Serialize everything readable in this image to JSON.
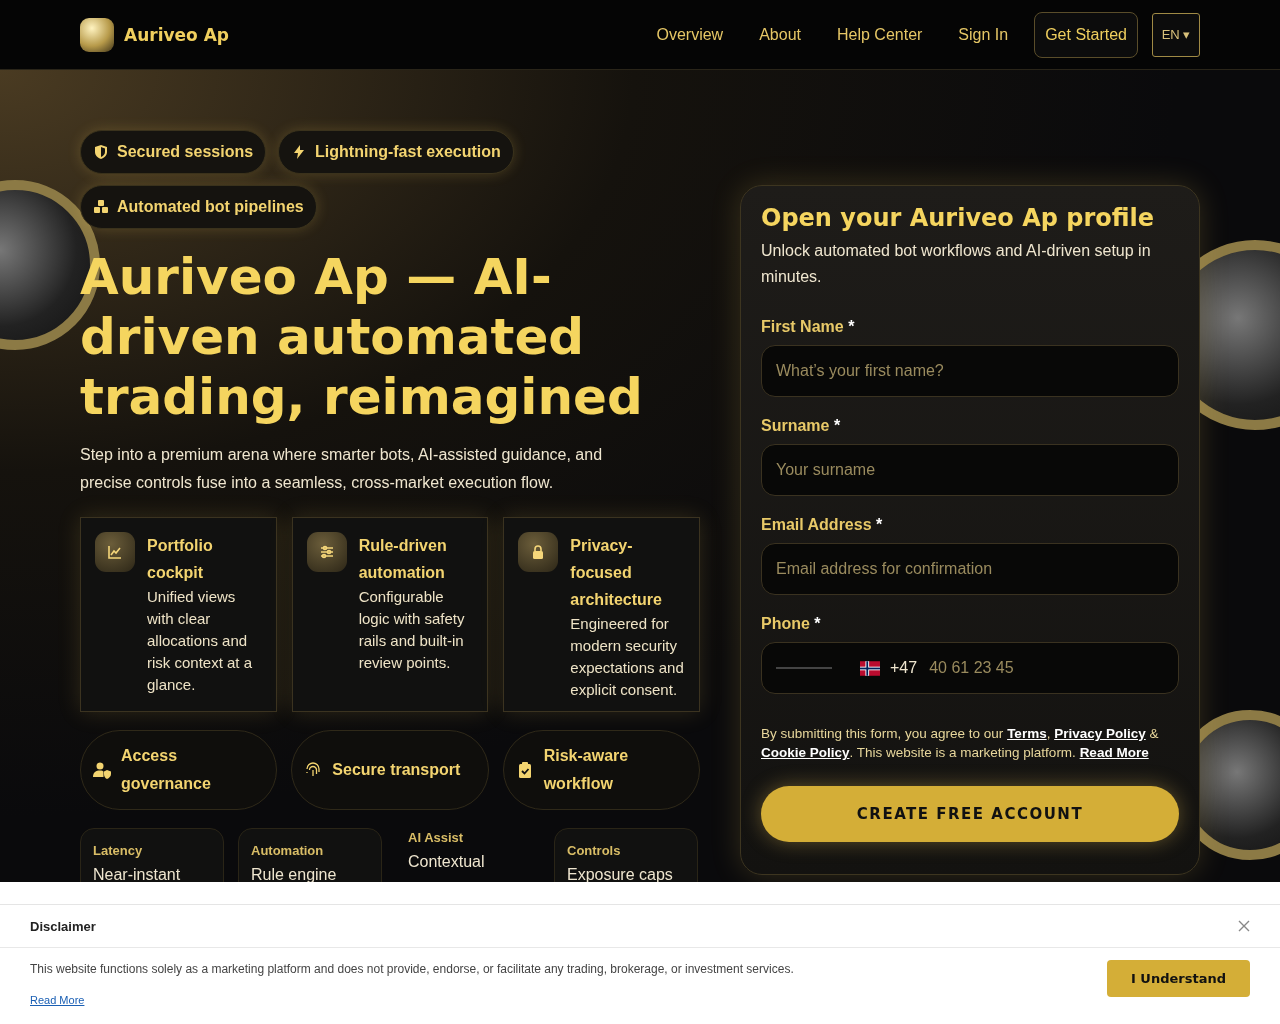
{
  "header": {
    "brand": "Auriveo Ap",
    "links": [
      "Overview",
      "About",
      "Help Center",
      "Sign In"
    ],
    "cta": "Get Started",
    "language": "EN ▾"
  },
  "hero": {
    "badges": [
      {
        "kind": "shield",
        "label": "Secured sessions"
      },
      {
        "kind": "bolt",
        "label": "Lightning-fast execution"
      },
      {
        "kind": "cubes",
        "label": "Automated bot pipelines"
      }
    ],
    "title": "Auriveo Ap — AI-driven automated trading, reimagined",
    "lead": "Step into a premium arena where smarter bots, AI-assisted guidance, and precise controls fuse into a seamless, cross-market execution flow.",
    "features": [
      {
        "kind": "chart",
        "title": "Portfolio cockpit",
        "text": "Unified views with clear allocations and risk context at a glance."
      },
      {
        "kind": "sliders",
        "title": "Rule-driven automation",
        "text": "Configurable logic with safety rails and built-in review points."
      },
      {
        "kind": "lock",
        "title": "Privacy-focused architecture",
        "text": "Engineered for modern security expectations and explicit consent."
      }
    ],
    "pills": [
      {
        "kind": "access",
        "label": "Access governance"
      },
      {
        "kind": "transport",
        "label": "Secure transport"
      },
      {
        "kind": "workflow",
        "label": "Risk-aware workflow"
      }
    ],
    "stats": [
      {
        "kind": "card",
        "label": "Latency",
        "value": "Near-instant"
      },
      {
        "kind": "card",
        "label": "Automation",
        "value": "Rule engine"
      },
      {
        "kind": "plain",
        "label": "AI Assist",
        "value": "Contextual"
      },
      {
        "kind": "card",
        "label": "Controls",
        "value": "Exposure caps"
      }
    ]
  },
  "form": {
    "title": "Open your Auriveo Ap profile",
    "subtitle": "Unlock automated bot workflows and AI-driven setup in minutes.",
    "fields": [
      {
        "kind": "text",
        "label": "First Name",
        "required_mark": "*",
        "placeholder": "What’s your first name?"
      },
      {
        "kind": "text",
        "label": "Surname",
        "required_mark": "*",
        "placeholder": "Your surname"
      },
      {
        "kind": "text",
        "label": "Email Address",
        "required_mark": "*",
        "placeholder": "Email address for confirmation"
      },
      {
        "kind": "phone",
        "label": "Phone",
        "required_mark": "*",
        "prefix": "+47",
        "placeholder": "40 61 23 45"
      }
    ],
    "consent": [
      {
        "kind": "text",
        "text": "By submitting this form, you agree to our "
      },
      {
        "kind": "link",
        "text": "Terms"
      },
      {
        "kind": "text",
        "text": ", "
      },
      {
        "kind": "link",
        "text": "Privacy Policy"
      },
      {
        "kind": "text",
        "text": " & "
      },
      {
        "kind": "link",
        "text": "Cookie Policy"
      },
      {
        "kind": "text",
        "text": ". This website is a marketing platform. "
      },
      {
        "kind": "link",
        "text": "Read More"
      }
    ],
    "submit": "CREATE FREE ACCOUNT"
  },
  "disclaimer": {
    "title": "Disclaimer",
    "text": "This website functions solely as a marketing platform and does not provide, endorse, or facilitate any trading, brokerage, or investment services.",
    "link": "Read More",
    "button": "I Understand"
  }
}
